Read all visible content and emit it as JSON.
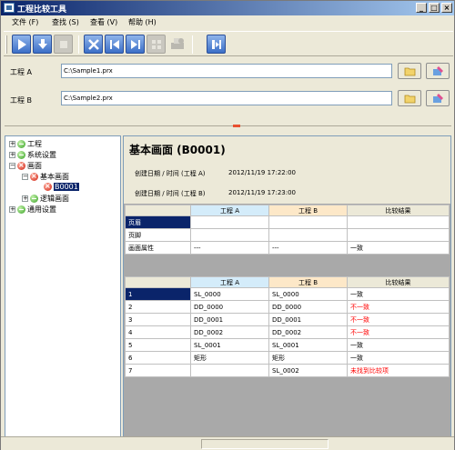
{
  "window": {
    "title": "工程比较工具"
  },
  "menu": {
    "items": [
      "文件 (F)",
      "查找 (S)",
      "查看 (V)",
      "帮助 (H)"
    ]
  },
  "project_a": {
    "label": "工程 A",
    "path": "C:\\Sample1.prx"
  },
  "project_b": {
    "label": "工程 B",
    "path": "C:\\Sample2.prx"
  },
  "tree": {
    "items": [
      {
        "label": "工程",
        "status": "green",
        "expander": "+"
      },
      {
        "label": "系统设置",
        "status": "green",
        "expander": "+"
      },
      {
        "label": "画面",
        "status": "red",
        "expander": "−"
      },
      {
        "label": "基本画面",
        "status": "red",
        "expander": "−"
      },
      {
        "label": "B0001",
        "status": "red",
        "expander": ""
      },
      {
        "label": "逻辑画面",
        "status": "green",
        "expander": "+"
      },
      {
        "label": "通用设置",
        "status": "green",
        "expander": "+"
      }
    ]
  },
  "detail": {
    "title": "基本画面 (B0001)",
    "created_a_label": "创建日期 / 时间 (工程 A)",
    "created_a_value": "2012/11/19 17:22:00",
    "created_b_label": "创建日期 / 时间 (工程 B)",
    "created_b_value": "2012/11/19 17:23:00"
  },
  "table1": {
    "headers": [
      "",
      "工程 A",
      "工程 B",
      "比较结果"
    ],
    "rows": [
      [
        "页眉",
        "",
        "",
        ""
      ],
      [
        "页脚",
        "",
        "",
        ""
      ],
      [
        "画面属性",
        "---",
        "---",
        "一致"
      ]
    ]
  },
  "table2": {
    "headers": [
      "",
      "工程 A",
      "工程 B",
      "比较结果"
    ],
    "rows": [
      [
        "1",
        "SL_0000",
        "SL_0000",
        "一致"
      ],
      [
        "2",
        "DD_0000",
        "DD_0000",
        "不一致"
      ],
      [
        "3",
        "DD_0001",
        "DD_0001",
        "不一致"
      ],
      [
        "4",
        "DD_0002",
        "DD_0002",
        "不一致"
      ],
      [
        "5",
        "SL_0001",
        "SL_0001",
        "一致"
      ],
      [
        "6",
        "矩形",
        "矩形",
        "一致"
      ],
      [
        "7",
        "",
        "SL_0002",
        "未找到比较项"
      ]
    ]
  },
  "colors": {
    "mismatch": "#ff0000",
    "selection": "#0a246a",
    "match_ok": "#34a020"
  }
}
